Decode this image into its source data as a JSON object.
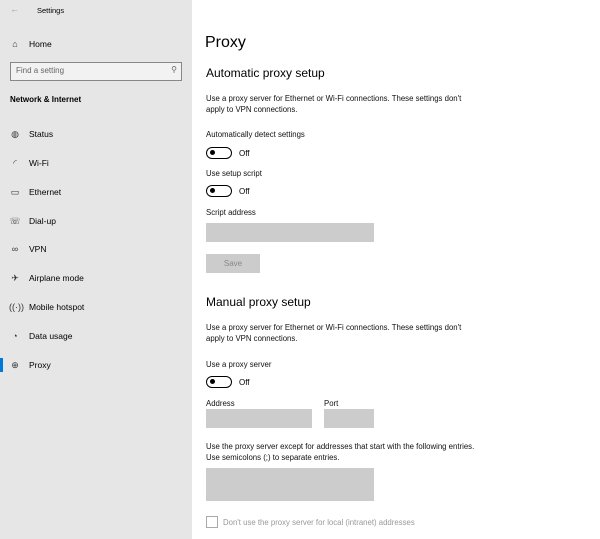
{
  "window": {
    "title": "Settings",
    "back_icon": "back-arrow-icon"
  },
  "sidebar": {
    "home": "Home",
    "search_placeholder": "Find a setting",
    "section": "Network & Internet",
    "items": [
      {
        "label": "Status",
        "icon": "globe-status-icon"
      },
      {
        "label": "Wi-Fi",
        "icon": "wifi-icon"
      },
      {
        "label": "Ethernet",
        "icon": "ethernet-icon"
      },
      {
        "label": "Dial-up",
        "icon": "dialup-icon"
      },
      {
        "label": "VPN",
        "icon": "vpn-icon"
      },
      {
        "label": "Airplane mode",
        "icon": "airplane-icon"
      },
      {
        "label": "Mobile hotspot",
        "icon": "hotspot-icon"
      },
      {
        "label": "Data usage",
        "icon": "data-usage-icon"
      },
      {
        "label": "Proxy",
        "icon": "globe-icon",
        "selected": true
      }
    ]
  },
  "main": {
    "title": "Proxy",
    "auto": {
      "heading": "Automatic proxy setup",
      "desc": "Use a proxy server for Ethernet or Wi-Fi connections. These settings don't apply to VPN connections.",
      "detect_label": "Automatically detect settings",
      "detect_state": "Off",
      "script_label": "Use setup script",
      "script_state": "Off",
      "address_label": "Script address",
      "save": "Save"
    },
    "manual": {
      "heading": "Manual proxy setup",
      "desc": "Use a proxy server for Ethernet or Wi-Fi connections. These settings don't apply to VPN connections.",
      "use_label": "Use a proxy server",
      "use_state": "Off",
      "address_label": "Address",
      "port_label": "Port",
      "except_desc": "Use the proxy server except for addresses that start with the following entries. Use semicolons (;) to separate entries.",
      "local_label": "Don't use the proxy server for local (intranet) addresses"
    }
  },
  "colors": {
    "accent": "#0078d7",
    "sidebar": "#e6e6e6"
  }
}
